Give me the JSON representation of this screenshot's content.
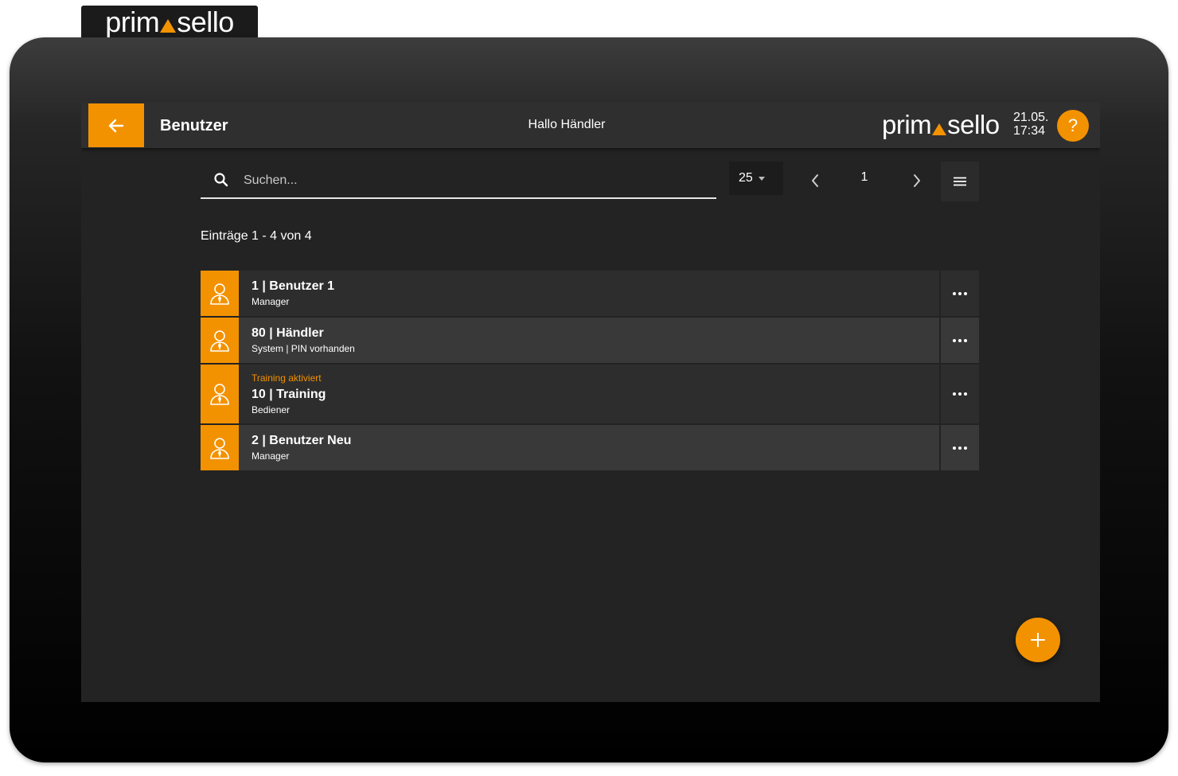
{
  "brand": {
    "logo_left": "prim",
    "logo_right": "sello",
    "accent_color": "#f39200"
  },
  "header": {
    "back_icon": "arrow-left-icon",
    "title": "Benutzer",
    "greeting": "Hallo Händler",
    "date": "21.05.",
    "time": "17:34",
    "help_label": "?"
  },
  "toolbar": {
    "search_placeholder": "Suchen...",
    "search_value": "",
    "page_size": "25",
    "current_page": "1",
    "icons": [
      "search-icon",
      "chevron-left-icon",
      "chevron-right-icon",
      "menu-icon"
    ]
  },
  "list": {
    "count_text": "Einträge 1 - 4 von 4",
    "items": [
      {
        "title": "1 | Benutzer 1",
        "subtitle": "Manager",
        "badge": ""
      },
      {
        "title": "80 | Händler",
        "subtitle": "System | PIN vorhanden",
        "badge": ""
      },
      {
        "title": "10 | Training",
        "subtitle": "Bediener",
        "badge": "Training aktiviert"
      },
      {
        "title": "2 | Benutzer Neu",
        "subtitle": "Manager",
        "badge": ""
      }
    ]
  },
  "fab": {
    "icon": "plus-icon"
  }
}
